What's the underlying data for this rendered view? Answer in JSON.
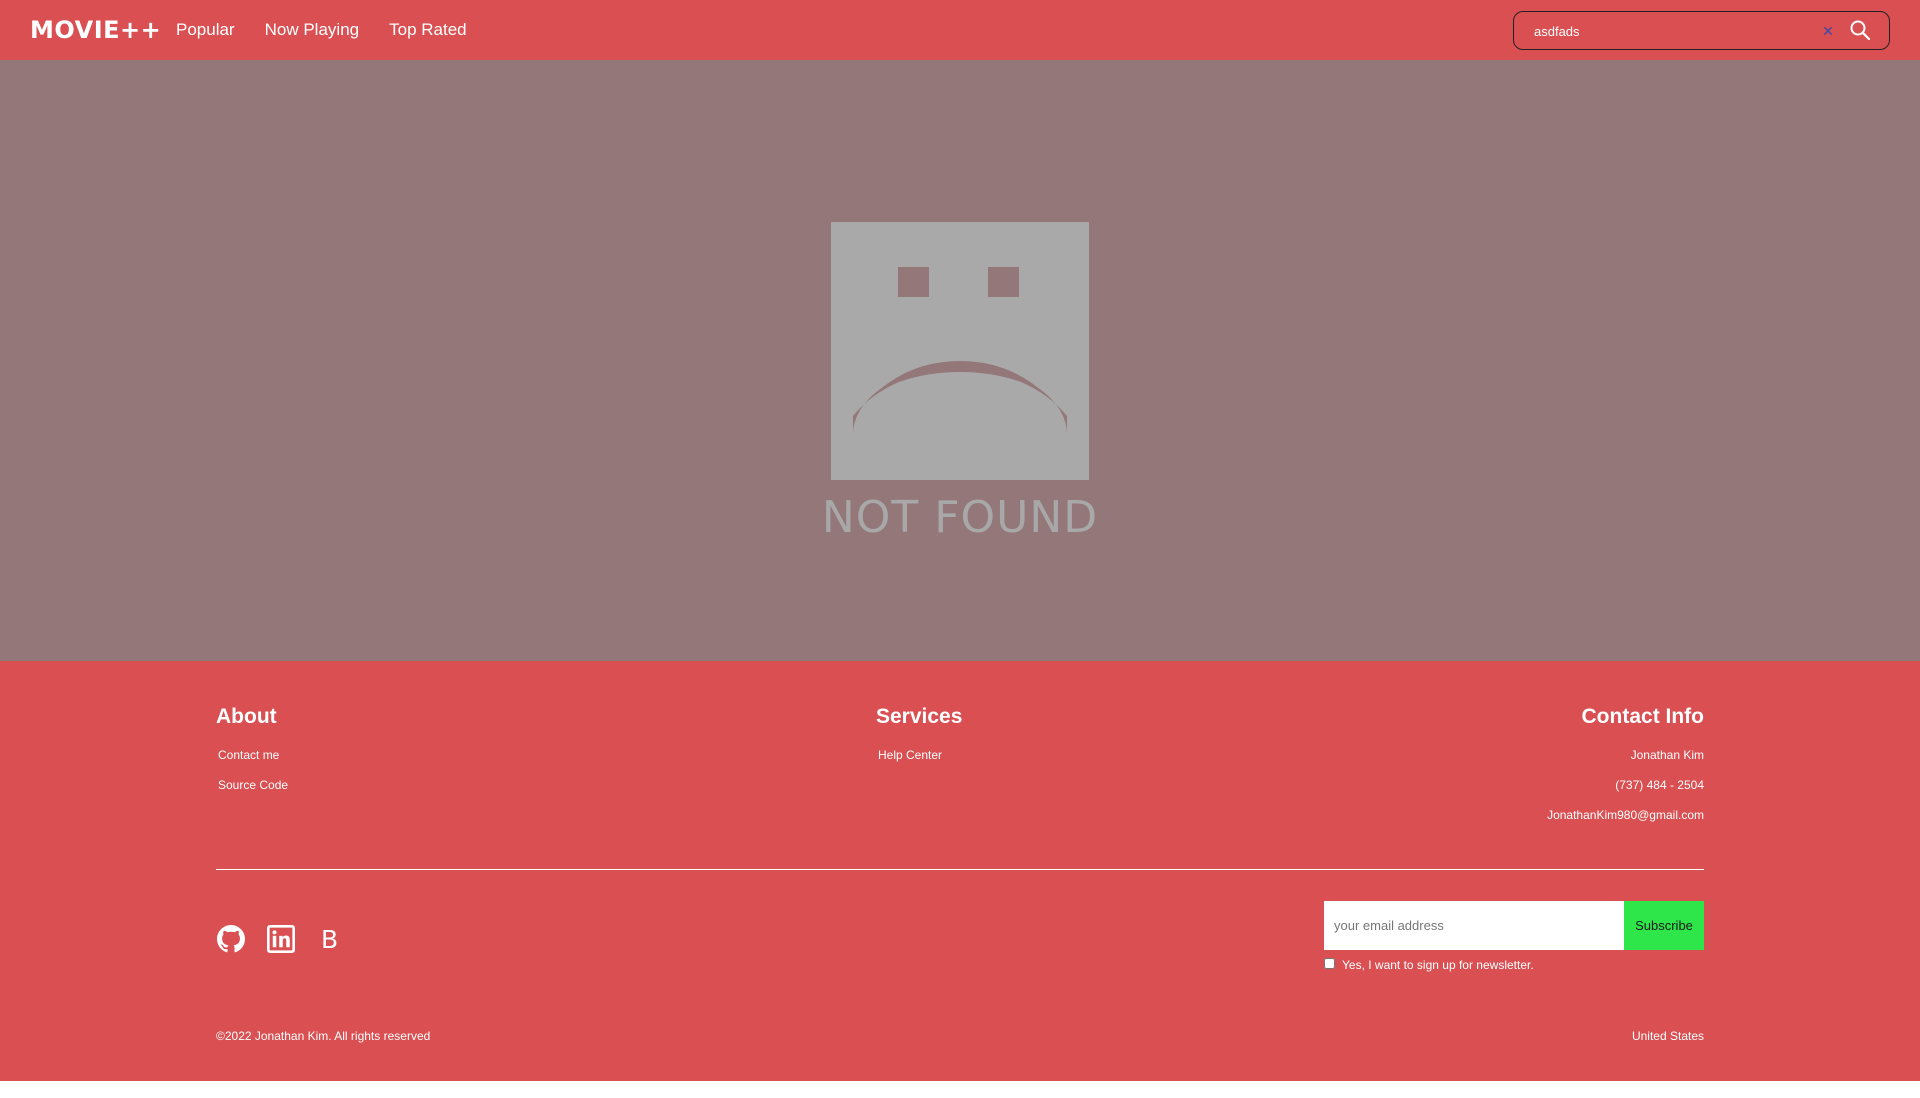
{
  "navbar": {
    "brand": "MOVIE++",
    "links": [
      "Popular",
      "Now Playing",
      "Top Rated"
    ],
    "search": {
      "value": "asdfads",
      "clear_icon": "close-icon",
      "search_icon": "search-icon"
    }
  },
  "main": {
    "illustration": "sad-face-icon",
    "message": "NOT FOUND"
  },
  "footer": {
    "about": {
      "title": "About",
      "links": [
        "Contact me",
        "Source Code"
      ]
    },
    "services": {
      "title": "Services",
      "links": [
        "Help Center"
      ]
    },
    "contact": {
      "title": "Contact Info",
      "name": "Jonathan Kim",
      "phone": "(737) 484 - 2504",
      "email": "JonathanKim980@gmail.com"
    },
    "social_icons": [
      "github-icon",
      "linkedin-icon",
      "blog-icon"
    ],
    "blog_letter": "B",
    "newsletter": {
      "placeholder": "your email address",
      "button": "Subscribe",
      "checkbox_label": "Yes, I want to sign up for newsletter."
    },
    "copyright": "©2022 Jonathan Kim. All rights reserved",
    "region": "United States"
  },
  "colors": {
    "brand_red": "#d94f52",
    "overlay": "#947779",
    "subscribe_green": "#2ee54a",
    "not_found_gray": "#a8a8a8"
  }
}
